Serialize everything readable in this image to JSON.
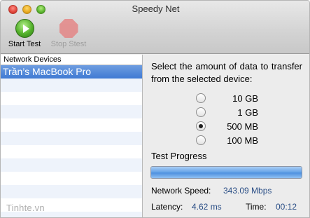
{
  "window": {
    "title": "Speedy Net"
  },
  "toolbar": {
    "start_label": "Start Test",
    "stop_label": "Stop Stest",
    "start_icon": "play-icon",
    "stop_icon": "stop-icon"
  },
  "sidebar": {
    "header": "Network Devices",
    "devices": [
      {
        "name": "Trần’s MacBook Pro",
        "selected": true
      }
    ]
  },
  "panel": {
    "prompt": "Select the amount of data to transfer from the selected device:",
    "options": [
      {
        "label": "10 GB",
        "checked": false
      },
      {
        "label": "1 GB",
        "checked": false
      },
      {
        "label": "500 MB",
        "checked": true
      },
      {
        "label": "100 MB",
        "checked": false
      }
    ],
    "progress_title": "Test Progress",
    "progress_fraction": 1.0,
    "speed_label": "Network Speed:",
    "speed_value": "343.09 Mbps",
    "latency_label": "Latency:",
    "latency_value": "4.62 ms",
    "time_label": "Time:",
    "time_value": "00:12"
  },
  "watermark": "Tinhte.vn",
  "colors": {
    "selection": "#3f79d3",
    "value_text": "#2a4e86",
    "progress": "#4f91e0"
  }
}
